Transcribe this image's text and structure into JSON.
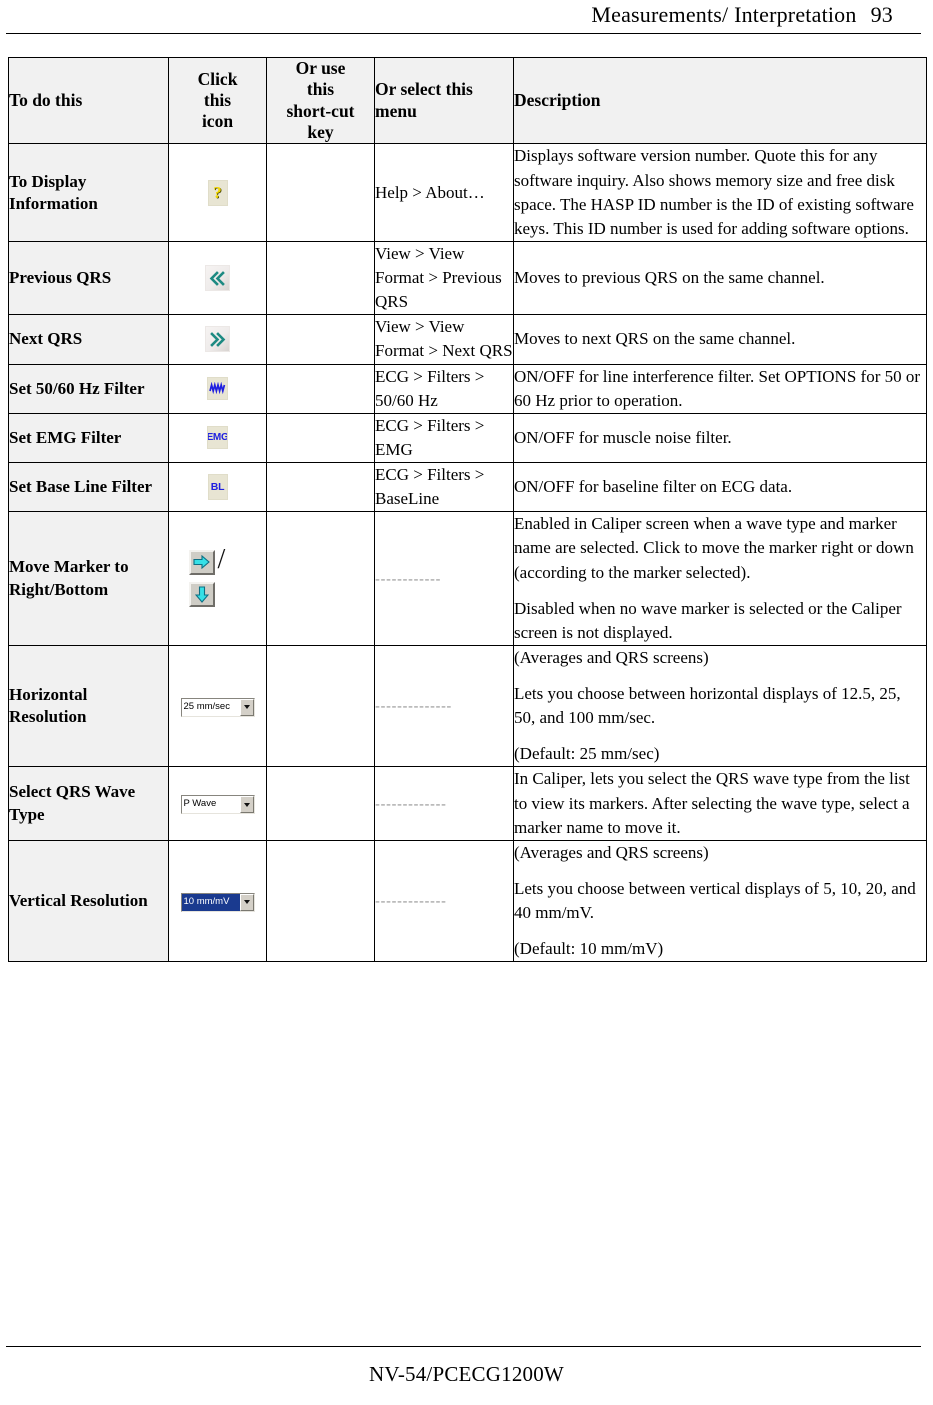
{
  "header": {
    "title": "Measurements/ Interpretation",
    "page_number": "93"
  },
  "footer": {
    "text": "NV-54/PCECG1200W"
  },
  "table": {
    "columns": [
      {
        "key": "todo",
        "label": "To do this"
      },
      {
        "key": "icon",
        "label": "Click this icon"
      },
      {
        "key": "shortcut",
        "label": "Or use this short-cut key"
      },
      {
        "key": "menu",
        "label": "Or select this menu"
      },
      {
        "key": "description",
        "label": "Description"
      }
    ],
    "column_labels": {
      "todo": "To do this",
      "icon_line1": "Click",
      "icon_line2": "this",
      "icon_line3": "icon",
      "key_line1": "Or use",
      "key_line2": "this",
      "key_line3": "short-cut",
      "key_line4": "key",
      "menu": "Or select this menu",
      "description": "Description"
    },
    "rows": [
      {
        "todo": "To Display Information",
        "icon_name": "help-question-icon",
        "icon_glyph": "?",
        "shortcut": "",
        "menu": "Help > About…",
        "description": [
          "Displays software version number. Quote this for any software inquiry. Also shows memory size and free disk space. The HASP ID number is the ID of existing software keys. This ID number is used for adding software options."
        ]
      },
      {
        "todo": "Previous QRS",
        "icon_name": "previous-qrs-icon",
        "icon_glyph": "«",
        "shortcut": "",
        "menu": "View > View Format > Previous QRS",
        "description": [
          "Moves to previous QRS on the same channel."
        ]
      },
      {
        "todo": "Next QRS",
        "icon_name": "next-qrs-icon",
        "icon_glyph": "»",
        "shortcut": "",
        "menu": "View > View Format > Next QRS",
        "description": [
          "Moves to next QRS on the same channel."
        ]
      },
      {
        "todo": "Set 50/60 Hz Filter",
        "icon_name": "line-filter-wave-icon",
        "icon_glyph": "",
        "shortcut": "",
        "menu": "ECG > Filters > 50/60 Hz",
        "description": [
          "ON/OFF for line interference filter. Set OPTIONS for 50 or 60 Hz prior to operation."
        ]
      },
      {
        "todo": "Set EMG Filter",
        "icon_name": "emg-filter-icon",
        "icon_glyph": "EMG",
        "shortcut": "",
        "menu": "ECG > Filters > EMG",
        "description": [
          "ON/OFF for muscle noise filter."
        ]
      },
      {
        "todo": "Set Base Line Filter",
        "icon_name": "baseline-filter-icon",
        "icon_glyph": "BL",
        "shortcut": "",
        "menu": "ECG > Filters > BaseLine",
        "description": [
          "ON/OFF for baseline filter on ECG data."
        ]
      },
      {
        "todo": "Move Marker to Right/Bottom",
        "icon_name": "move-marker-arrows-icon",
        "icon_glyph": "",
        "shortcut": "",
        "menu": "------------",
        "description": [
          "Enabled in Caliper screen when a wave type and marker name are selected. Click to move the marker right or down (according to the marker selected).",
          "Disabled when no wave marker is selected or the Caliper screen is not displayed."
        ]
      },
      {
        "todo": "Horizontal Resolution",
        "icon_name": "horizontal-resolution-combobox",
        "icon_glyph": "",
        "combo_value": "25 mm/sec",
        "combo_selected": false,
        "shortcut": "",
        "menu": "--------------",
        "description": [
          "(Averages and QRS screens)",
          "Lets you choose between horizontal displays of 12.5, 25, 50, and 100 mm/sec.",
          "(Default: 25 mm/sec)"
        ]
      },
      {
        "todo": "Select QRS Wave Type",
        "icon_name": "qrs-wave-type-combobox",
        "icon_glyph": "",
        "combo_value": "P Wave",
        "combo_selected": false,
        "shortcut": "",
        "menu": "-------------",
        "description": [
          "In Caliper, lets you select the QRS wave type from the list to view its markers. After selecting the wave type, select a marker name to move it."
        ]
      },
      {
        "todo": "Vertical Resolution",
        "icon_name": "vertical-resolution-combobox",
        "icon_glyph": "",
        "combo_value": "10 mm/mV",
        "combo_selected": true,
        "shortcut": "",
        "menu": "-------------",
        "description": [
          "(Averages and QRS screens)",
          "Lets you choose between vertical displays of 5, 10, 20, and 40 mm/mV.",
          "(Default: 10 mm/mV)"
        ]
      }
    ]
  },
  "colors": {
    "header_fill": "#f1f1f1",
    "icon_beige": "#e8e5d3",
    "icon_blue": "#2020e0",
    "icon_teal": "#1d8a82",
    "icon_cyan": "#36e0e6",
    "selection_blue": "#1a3a8f",
    "question_yellow": "#f2d600"
  }
}
